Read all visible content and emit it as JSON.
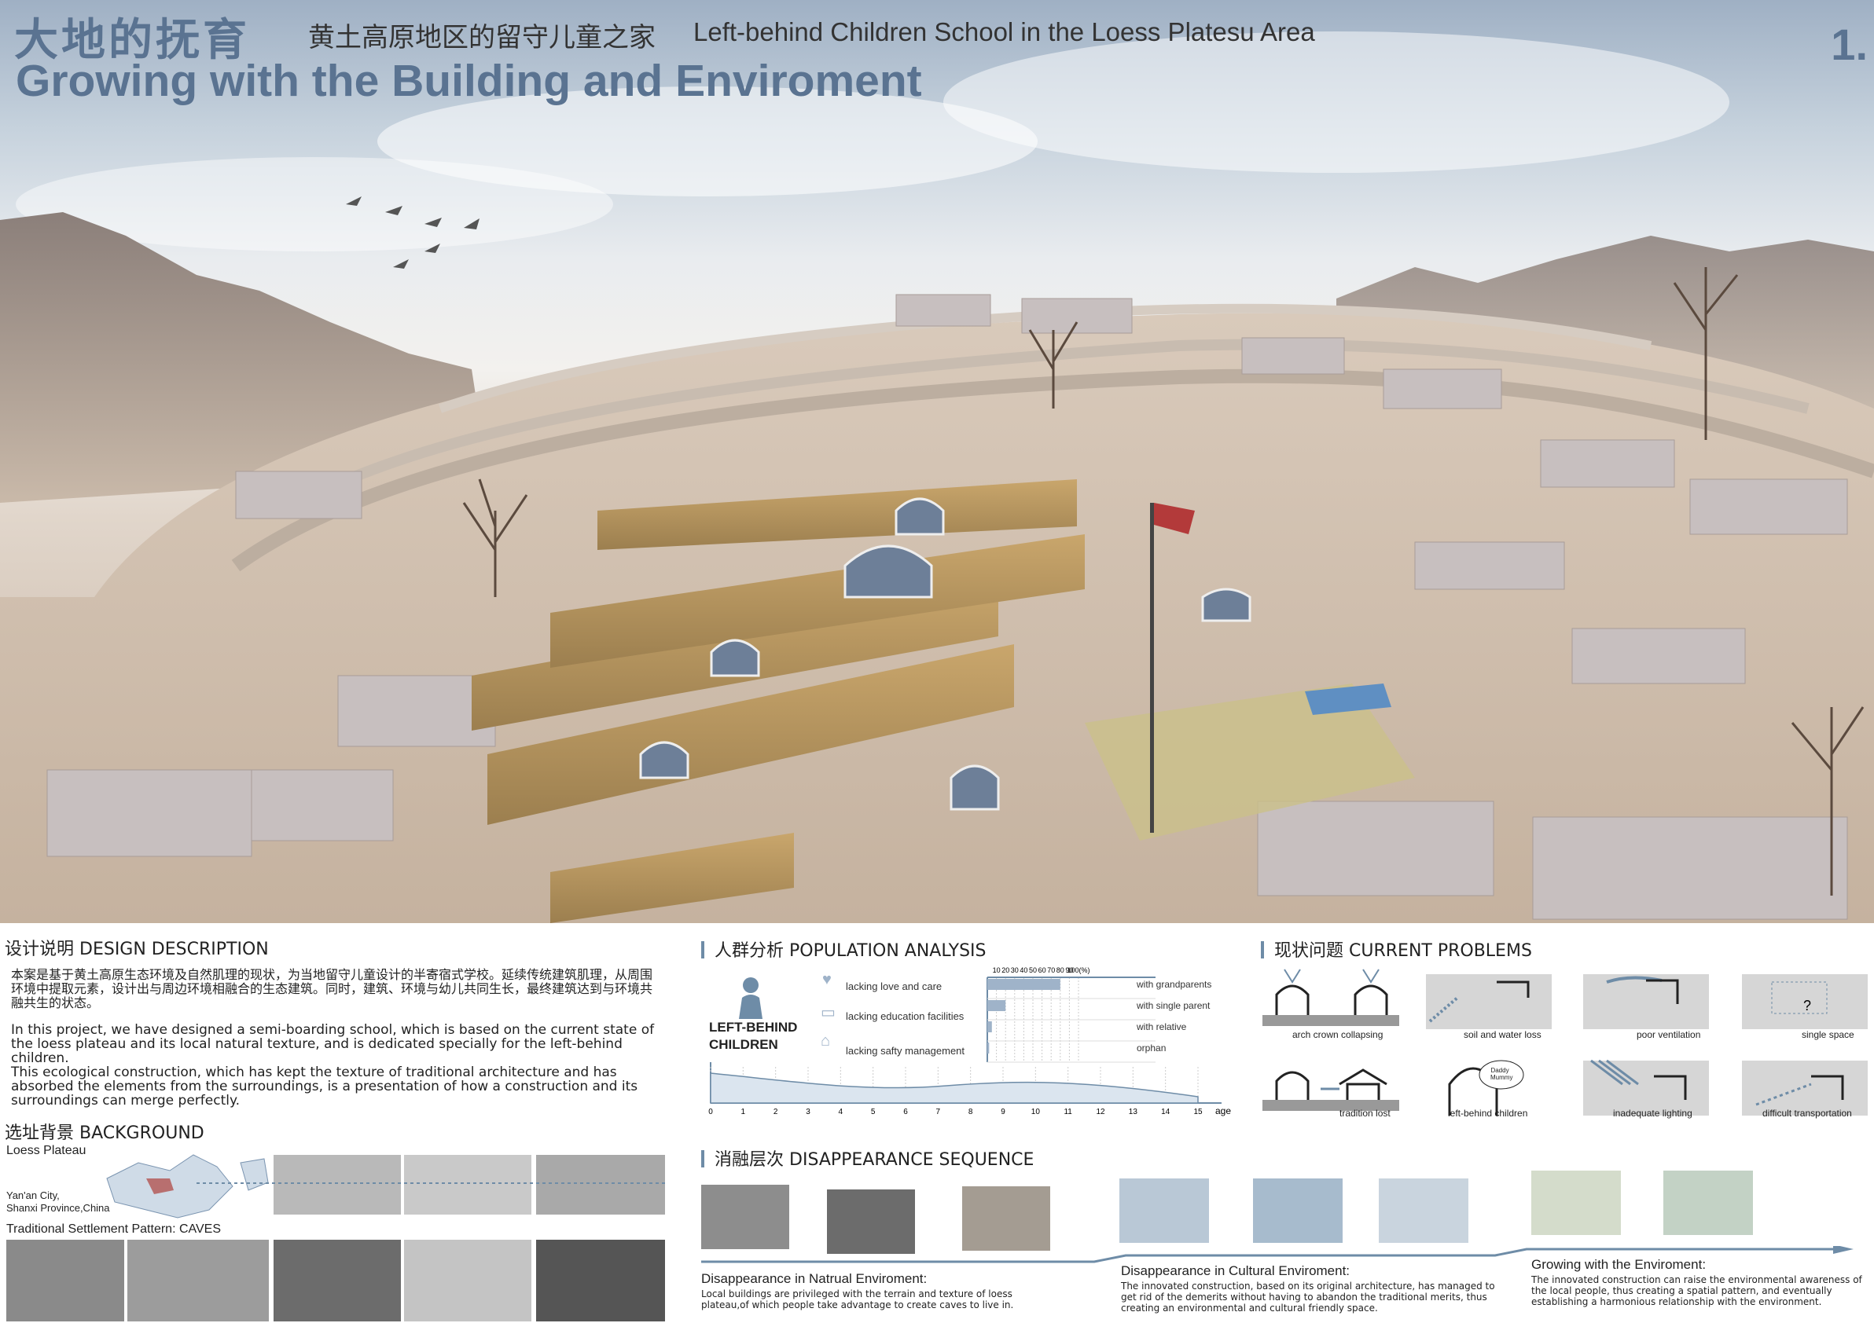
{
  "header": {
    "title_cn": "大地的抚育",
    "subtitle_cn": "黄土高原地区的留守儿童之家",
    "subtitle_en": "Left-behind Children School in the Loess Platesu Area",
    "title_en": "Growing with the Building and Enviroment",
    "page_number": "1."
  },
  "design": {
    "heading_cn": "设计说明",
    "heading_en": "DESIGN DESCRIPTION",
    "text_cn": "本案是基于黄土高原生态环境及自然肌理的现状，为当地留守儿童设计的半寄宿式学校。延续传统建筑肌理，从周围环境中提取元素，设计出与周边环境相融合的生态建筑。同时，建筑、环境与幼儿共同生长，最终建筑达到与环境共融共生的状态。",
    "text_en_1": "In this project, we have designed a semi-boarding school, which is based on the current state of the loess plateau and its local natural texture, and is dedicated specially for the left-behind children.",
    "text_en_2": "This ecological construction, which has kept the texture of traditional architecture and has absorbed the elements from the surroundings, is a presentation of how a construction and its surroundings can merge perfectly."
  },
  "background": {
    "heading_cn": "选址背景",
    "heading_en": "BACKGROUND",
    "loess_label": "Loess Plateau",
    "location_label_1": "Yan'an City,",
    "location_label_2": "Shanxi Province,China",
    "pattern_label": "Traditional Settlement Pattern: CAVES"
  },
  "population": {
    "heading_cn": "人群分析",
    "heading_en": "POPULATION ANALYSIS",
    "group_label_1": "LEFT-BEHIND",
    "group_label_2": "CHILDREN",
    "needs": [
      "lacking love and care",
      "lacking education facilities",
      "lacking safty management"
    ],
    "percent_ticks": [
      "10",
      "20",
      "30",
      "40",
      "50",
      "60",
      "70",
      "80",
      "90",
      "100(%)"
    ],
    "categories": [
      "with grandparents",
      "with single parent",
      "with relative",
      "orphan"
    ],
    "percent_values": [
      80,
      20,
      5,
      2
    ],
    "age_ticks": [
      "0",
      "1",
      "2",
      "3",
      "4",
      "5",
      "6",
      "7",
      "8",
      "9",
      "10",
      "11",
      "12",
      "13",
      "14",
      "15"
    ],
    "age_axis_label": "age"
  },
  "problems": {
    "heading_cn": "现状问题",
    "heading_en": "CURRENT PROBLEMS",
    "items": [
      "arch crown collapsing",
      "soil and water loss",
      "poor ventilation",
      "single space",
      "tradition lost",
      "left-behind children",
      "inadequate lighting",
      "difficult transportation"
    ],
    "bubble_text": "Daddy Mummy"
  },
  "sequence": {
    "heading_cn": "消融层次",
    "heading_en": "DISAPPEARANCE SEQUENCE",
    "stages": [
      {
        "title": "Disappearance in Natrual Enviroment:",
        "text": "Local buildings are privileged with the terrain and texture of loess plateau,of which people take advantage to create caves to live in."
      },
      {
        "title": "Disappearance in Cultural Enviroment:",
        "text": "The innovated construction, based on its original architecture, has managed to get rid of the demerits without having to  abandon the traditional merits, thus creating an environmental and cultural friendly space."
      },
      {
        "title": "Growing with the Enviroment:",
        "text": "The innovated construction can raise the environmental awareness of the local people, thus creating a spatial pattern, and eventually establishing a harmonious relationship with the environment."
      }
    ]
  },
  "colors": {
    "accent": "#5a7391",
    "line": "#6e8ca7"
  }
}
